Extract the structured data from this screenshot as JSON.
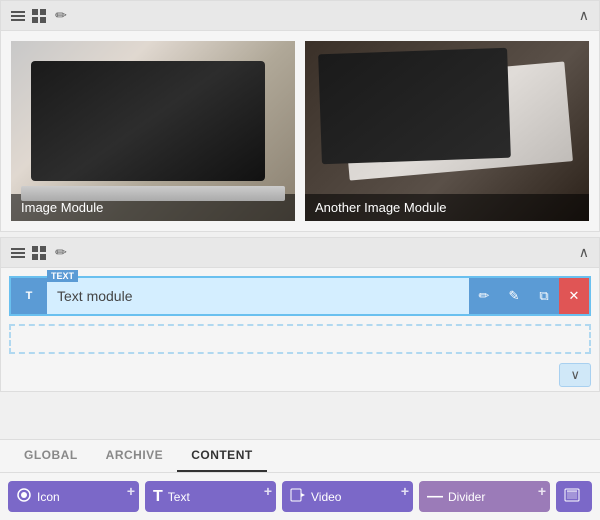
{
  "sections": {
    "first_section": {
      "toolbar": {
        "hamburger_icon": "hamburger",
        "grid_icon": "grid",
        "edit_icon": "✏",
        "collapse_icon": "∧"
      },
      "image_modules": [
        {
          "label": "Image Module"
        },
        {
          "label": "Another Image Module"
        }
      ]
    },
    "second_section": {
      "toolbar": {
        "hamburger_icon": "hamburger",
        "grid_icon": "grid",
        "edit_icon": "✏",
        "collapse_icon": "∧"
      },
      "text_module": {
        "tag": "TEXT",
        "name": "Text module",
        "actions": {
          "edit": "✏",
          "pencil": "✎",
          "copy": "⧉",
          "close": "✕"
        }
      },
      "collapse_button_label": "∨"
    }
  },
  "tabs": {
    "items": [
      {
        "id": "global",
        "label": "GLOBAL",
        "active": false
      },
      {
        "id": "archive",
        "label": "ARCHIVE",
        "active": false
      },
      {
        "id": "content",
        "label": "CONTENT",
        "active": true
      }
    ]
  },
  "content_buttons": [
    {
      "id": "icon",
      "icon": "⬟",
      "label": "Icon"
    },
    {
      "id": "text",
      "icon": "T",
      "label": "Text"
    },
    {
      "id": "video",
      "icon": "▶",
      "label": "Video"
    },
    {
      "id": "divider",
      "icon": "—",
      "label": "Divider"
    },
    {
      "id": "more",
      "icon": "🖼",
      "label": ""
    }
  ],
  "colors": {
    "accent_blue": "#5b9bd5",
    "light_blue_bg": "#d4eeff",
    "purple": "#7b68c8",
    "close_red": "#e05555"
  }
}
